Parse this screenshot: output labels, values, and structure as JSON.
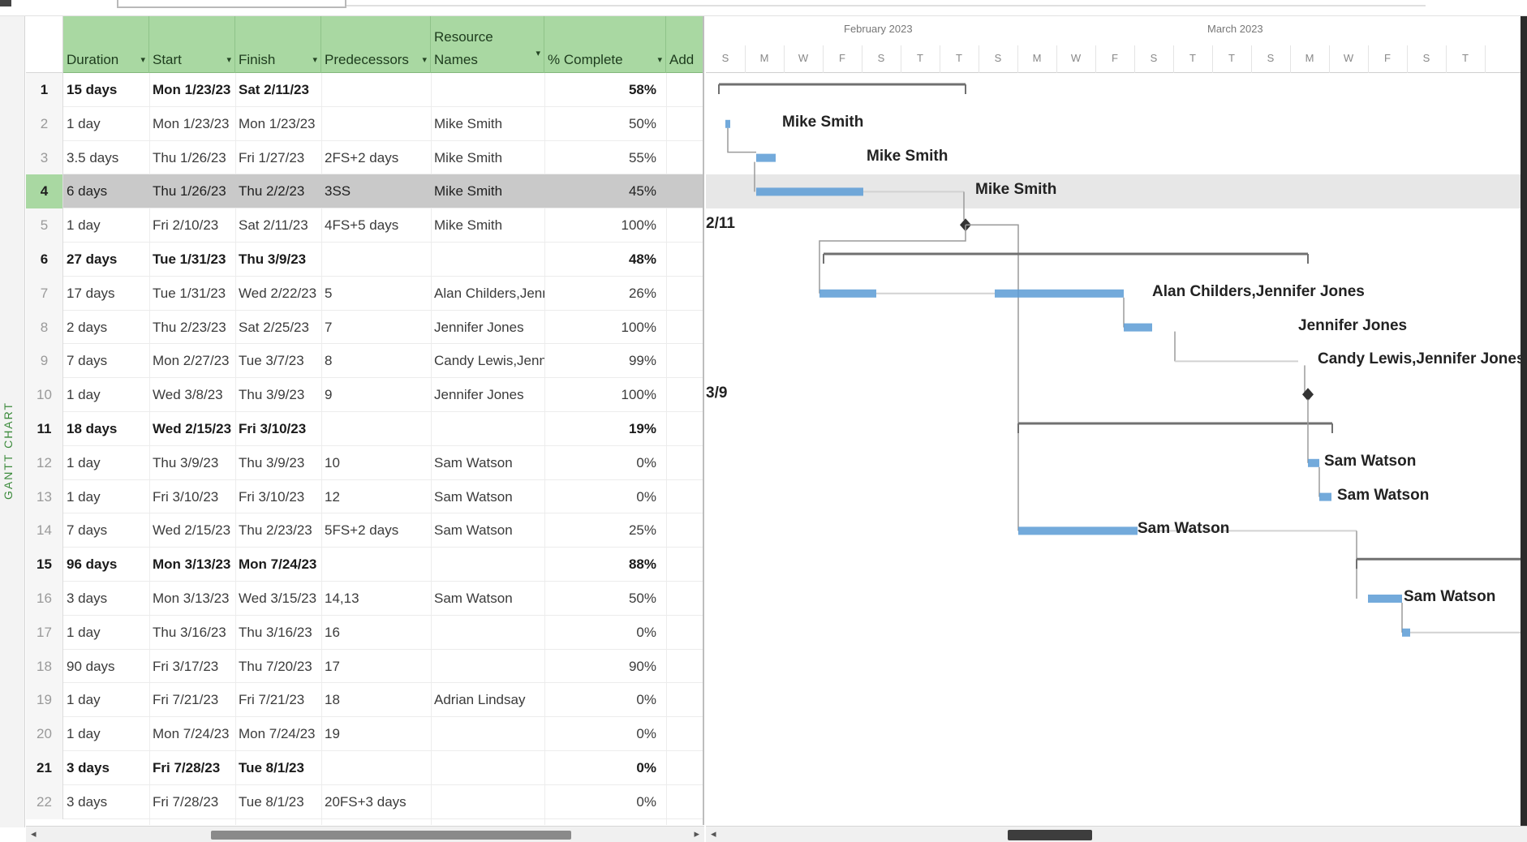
{
  "view": {
    "label": "GANTT CHART"
  },
  "columns": [
    {
      "key": "duration",
      "label": "Duration"
    },
    {
      "key": "start",
      "label": "Start"
    },
    {
      "key": "finish",
      "label": "Finish"
    },
    {
      "key": "pred",
      "label": "Predecessors"
    },
    {
      "key": "res",
      "label": "Resource Names",
      "line1": "Resource",
      "line2": "Names"
    },
    {
      "key": "pct",
      "label": "% Complete"
    },
    {
      "key": "add",
      "label": "Add"
    }
  ],
  "rows": [
    {
      "id": "1",
      "duration": "15 days",
      "start": "Mon 1/23/23",
      "finish": "Sat 2/11/23",
      "pred": "",
      "res": "",
      "pct": "58%",
      "summary": true
    },
    {
      "id": "2",
      "duration": "1 day",
      "start": "Mon 1/23/23",
      "finish": "Mon 1/23/23",
      "pred": "",
      "res": "Mike Smith",
      "pct": "50%",
      "summary": false
    },
    {
      "id": "3",
      "duration": "3.5 days",
      "start": "Thu 1/26/23",
      "finish": "Fri 1/27/23",
      "pred": "2FS+2 days",
      "res": "Mike Smith",
      "pct": "55%",
      "summary": false
    },
    {
      "id": "4",
      "duration": "6 days",
      "start": "Thu 1/26/23",
      "finish": "Thu 2/2/23",
      "pred": "3SS",
      "res": "Mike Smith",
      "pct": "45%",
      "summary": false,
      "selected": true
    },
    {
      "id": "5",
      "duration": "1 day",
      "start": "Fri 2/10/23",
      "finish": "Sat 2/11/23",
      "pred": "4FS+5 days",
      "res": "Mike Smith",
      "pct": "100%",
      "summary": false
    },
    {
      "id": "6",
      "duration": "27 days",
      "start": "Tue 1/31/23",
      "finish": "Thu 3/9/23",
      "pred": "",
      "res": "",
      "pct": "48%",
      "summary": true
    },
    {
      "id": "7",
      "duration": "17 days",
      "start": "Tue 1/31/23",
      "finish": "Wed 2/22/23",
      "pred": "5",
      "res": "Alan Childers,Jenni",
      "pct": "26%",
      "summary": false
    },
    {
      "id": "8",
      "duration": "2 days",
      "start": "Thu 2/23/23",
      "finish": "Sat 2/25/23",
      "pred": "7",
      "res": "Jennifer Jones",
      "pct": "100%",
      "summary": false
    },
    {
      "id": "9",
      "duration": "7 days",
      "start": "Mon 2/27/23",
      "finish": "Tue 3/7/23",
      "pred": "8",
      "res": "Candy Lewis,Jenni",
      "pct": "99%",
      "summary": false
    },
    {
      "id": "10",
      "duration": "1 day",
      "start": "Wed 3/8/23",
      "finish": "Thu 3/9/23",
      "pred": "9",
      "res": "Jennifer Jones",
      "pct": "100%",
      "summary": false
    },
    {
      "id": "11",
      "duration": "18 days",
      "start": "Wed 2/15/23",
      "finish": "Fri 3/10/23",
      "pred": "",
      "res": "",
      "pct": "19%",
      "summary": true
    },
    {
      "id": "12",
      "duration": "1 day",
      "start": "Thu 3/9/23",
      "finish": "Thu 3/9/23",
      "pred": "10",
      "res": "Sam Watson",
      "pct": "0%",
      "summary": false
    },
    {
      "id": "13",
      "duration": "1 day",
      "start": "Fri 3/10/23",
      "finish": "Fri 3/10/23",
      "pred": "12",
      "res": "Sam Watson",
      "pct": "0%",
      "summary": false
    },
    {
      "id": "14",
      "duration": "7 days",
      "start": "Wed 2/15/23",
      "finish": "Thu 2/23/23",
      "pred": "5FS+2 days",
      "res": "Sam Watson",
      "pct": "25%",
      "summary": false
    },
    {
      "id": "15",
      "duration": "96 days",
      "start": "Mon 3/13/23",
      "finish": "Mon 7/24/23",
      "pred": "",
      "res": "",
      "pct": "88%",
      "summary": true
    },
    {
      "id": "16",
      "duration": "3 days",
      "start": "Mon 3/13/23",
      "finish": "Wed 3/15/23",
      "pred": "14,13",
      "res": "Sam Watson",
      "pct": "50%",
      "summary": false
    },
    {
      "id": "17",
      "duration": "1 day",
      "start": "Thu 3/16/23",
      "finish": "Thu 3/16/23",
      "pred": "16",
      "res": "",
      "pct": "0%",
      "summary": false
    },
    {
      "id": "18",
      "duration": "90 days",
      "start": "Fri 3/17/23",
      "finish": "Thu 7/20/23",
      "pred": "17",
      "res": "",
      "pct": "90%",
      "summary": false
    },
    {
      "id": "19",
      "duration": "1 day",
      "start": "Fri 7/21/23",
      "finish": "Fri 7/21/23",
      "pred": "18",
      "res": "Adrian Lindsay",
      "pct": "0%",
      "summary": false
    },
    {
      "id": "20",
      "duration": "1 day",
      "start": "Mon 7/24/23",
      "finish": "Mon 7/24/23",
      "pred": "19",
      "res": "",
      "pct": "0%",
      "summary": false
    },
    {
      "id": "21",
      "duration": "3 days",
      "start": "Fri 7/28/23",
      "finish": "Tue 8/1/23",
      "pred": "",
      "res": "",
      "pct": "0%",
      "summary": true
    },
    {
      "id": "22",
      "duration": "3 days",
      "start": "Fri 7/28/23",
      "finish": "Tue 8/1/23",
      "pred": "20FS+3 days",
      "res": "",
      "pct": "0%",
      "summary": false
    }
  ],
  "timescale": {
    "months": [
      "February 2023",
      "March 2023"
    ],
    "days": [
      "S",
      "M",
      "W",
      "F",
      "S",
      "T",
      "T",
      "S",
      "M",
      "W",
      "F",
      "S",
      "T",
      "T",
      "S",
      "M",
      "W",
      "F",
      "S",
      "T"
    ]
  },
  "gantt_labels": [
    {
      "row": 1,
      "text": "Mike Smith"
    },
    {
      "row": 2,
      "text": "Mike Smith"
    },
    {
      "row": 3,
      "text": "Mike Smith"
    },
    {
      "row": 4,
      "text": "2/11"
    },
    {
      "row": 6,
      "text": "Alan Childers,Jennifer Jones"
    },
    {
      "row": 7,
      "text": "Jennifer Jones"
    },
    {
      "row": 8,
      "text": "Candy Lewis,Jennifer Jones"
    },
    {
      "row": 9,
      "text": "3/9"
    },
    {
      "row": 11,
      "text": "Sam Watson"
    },
    {
      "row": 12,
      "text": "Sam Watson"
    },
    {
      "row": 13,
      "text": "Sam Watson"
    },
    {
      "row": 15,
      "text": "Sam Watson"
    }
  ],
  "colors": {
    "header_green": "#a9d8a2",
    "bar_blue": "#5b9bd5",
    "summary_gray": "#707070"
  }
}
